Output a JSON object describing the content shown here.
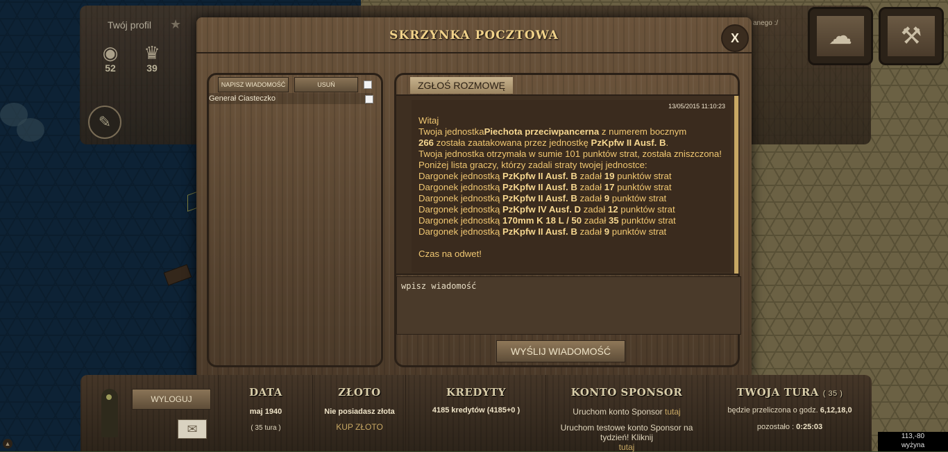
{
  "top_bar": {
    "profile_label": "Twój profil",
    "stats": [
      {
        "icon": "globe-laurel-icon",
        "value": "52"
      },
      {
        "icon": "trophy-laurel-icon",
        "value": "39"
      }
    ],
    "news_tail": "anego :/"
  },
  "mailbox": {
    "title": "SKRZYNKA POCZTOWA",
    "close_label": "X",
    "write_button": "NAPISZ WIADOMOŚĆ",
    "delete_button": "USUŃ",
    "conversations": [
      {
        "name": "Generał Ciasteczko"
      }
    ],
    "report_button": "ZGŁOŚ ROZMOWĘ",
    "message": {
      "date": "13/05/2015 11:10:23",
      "greeting": "Witaj",
      "unit_pre": "Twoja jednostka",
      "unit_name": "Piechota przeciwpancerna",
      "unit_mid": " z numerem bocznym",
      "unit_number": "266",
      "attack_pre": " została zaatakowana przez jednostkę ",
      "attacker": "PzKpfw II Ausf. B",
      "attack_end": ".",
      "summary": "Twoja jednostka otrzymała w sumie 101 punktów strat, została zniszczona!",
      "list_intro": "Poniżej lista graczy, którzy zadali straty twojej jednostce:",
      "damage_rows": [
        {
          "player": "Dargonek",
          "unit_word": " jednostką ",
          "unit": "PzKpfw II Ausf. B",
          "dealt": " zadał ",
          "points": "19",
          "suffix": " punktów strat"
        },
        {
          "player": "Dargonek",
          "unit_word": " jednostką ",
          "unit": "PzKpfw II Ausf. B",
          "dealt": " zadał ",
          "points": "17",
          "suffix": " punktów strat"
        },
        {
          "player": "Dargonek",
          "unit_word": " jednostką ",
          "unit": "PzKpfw II Ausf. B",
          "dealt": " zadał ",
          "points": "9",
          "suffix": " punktów strat"
        },
        {
          "player": "Dargonek",
          "unit_word": " jednostką ",
          "unit": "PzKpfw IV Ausf. D",
          "dealt": " zadał ",
          "points": "12",
          "suffix": " punktów strat"
        },
        {
          "player": "Dargonek",
          "unit_word": " jednostką ",
          "unit": "170mm K 18 L / 50",
          "dealt": " zadał ",
          "points": "35",
          "suffix": " punktów strat"
        },
        {
          "player": "Dargonek",
          "unit_word": " jednostką ",
          "unit": "PzKpfw II Ausf. B",
          "dealt": " zadał ",
          "points": "9",
          "suffix": " punktów strat"
        }
      ],
      "closing": "Czas na odwet!"
    },
    "input_placeholder": "wpisz wiadomość",
    "send_button": "WYŚLIJ WIADOMOŚĆ"
  },
  "bottom_bar": {
    "logout_button": "WYLOGUJ",
    "date": {
      "heading": "DATA",
      "value": "maj 1940",
      "turn": "( 35 tura )"
    },
    "gold": {
      "heading": "ZŁOTO",
      "status": "Nie posiadasz złota",
      "buy": "KUP ZŁOTO"
    },
    "credits": {
      "heading": "KREDYTY",
      "value": "4185 kredytów (4185+0 )"
    },
    "sponsor": {
      "heading": "KONTO SPONSOR",
      "line1_pre": "Uruchom konto Sponsor ",
      "line1_link": "tutaj",
      "line2": "Uruchom testowe konto Sponsor na tydzień! Kliknij",
      "line2_link": "tutaj"
    },
    "turn": {
      "heading": "TWOJA TURA",
      "number": "( 35 )",
      "calc_pre": "będzie przeliczona o godz. ",
      "calc_hours": "6,12,18,0",
      "remaining_pre": "pozostało : ",
      "remaining": "0:25:03"
    }
  },
  "map_info": {
    "coords": "113,-80",
    "terrain": "wyżyna"
  }
}
